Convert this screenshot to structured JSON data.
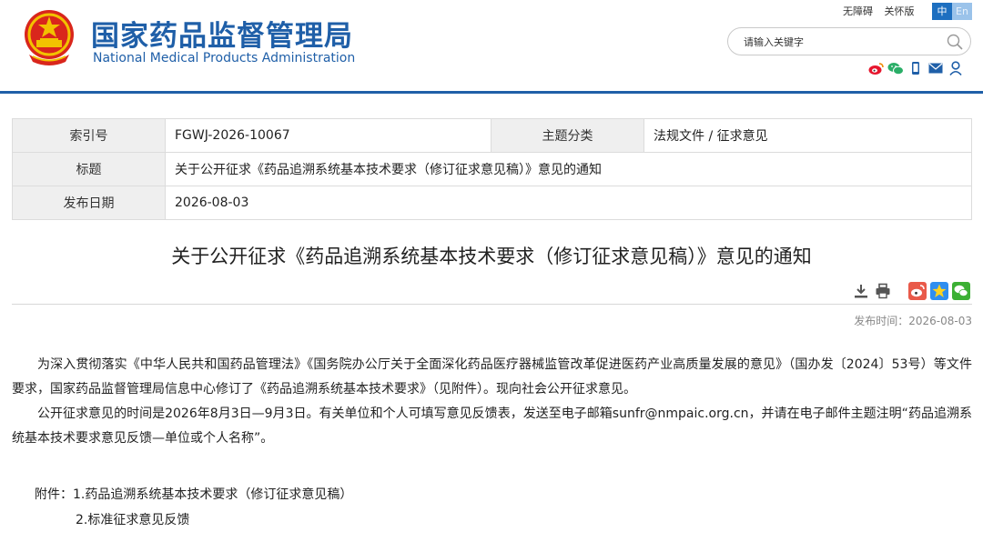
{
  "header": {
    "title_cn": "国家药品监督管理局",
    "title_en": "National Medical Products Administration",
    "links": [
      "无障碍",
      "关怀版"
    ],
    "lang_cn": "中",
    "lang_en": "En",
    "search_placeholder": "请输入关键字",
    "social_icons": [
      "weibo-icon",
      "wechat-icon",
      "mobile-icon",
      "mail-icon",
      "user-icon"
    ],
    "brand_color": "#1f5fa8"
  },
  "info": {
    "index_label": "索引号",
    "index_value": "FGWJ-2026-10067",
    "category_label": "主题分类",
    "category_value": "法规文件 / 征求意见",
    "title_label": "标题",
    "title_value": "关于公开征求《药品追溯系统基本技术要求（修订征求意见稿）》意见的通知",
    "date_label": "发布日期",
    "date_value": "2026-08-03"
  },
  "article": {
    "title": "关于公开征求《药品追溯系统基本技术要求（修订征求意见稿）》意见的通知",
    "pub_date": "发布时间：2026-08-03",
    "paragraphs": [
      "为深入贯彻落实《中华人民共和国药品管理法》《国务院办公厅关于全面深化药品医疗器械监管改革促进医药产业高质量发展的意见》（国办发〔2024〕53号）等文件要求，国家药品监督管理局信息中心修订了《药品追溯系统基本技术要求》（见附件）。现向社会公开征求意见。",
      "公开征求意见的时间是2026年8月3日—9月3日。有关单位和个人可填写意见反馈表，发送至电子邮箱sunfr@nmpaic.org.cn，并请在电子邮件主题注明“药品追溯系统基本技术要求意见反馈—单位或个人名称”。"
    ],
    "attachments": [
      "附件：1.药品追溯系统基本技术要求（修订征求意见稿）",
      "2.标准征求意见反馈"
    ],
    "tool_icons": [
      "download-icon",
      "print-icon",
      "share-weibo-icon",
      "share-qzone-icon",
      "share-wechat-icon"
    ]
  }
}
